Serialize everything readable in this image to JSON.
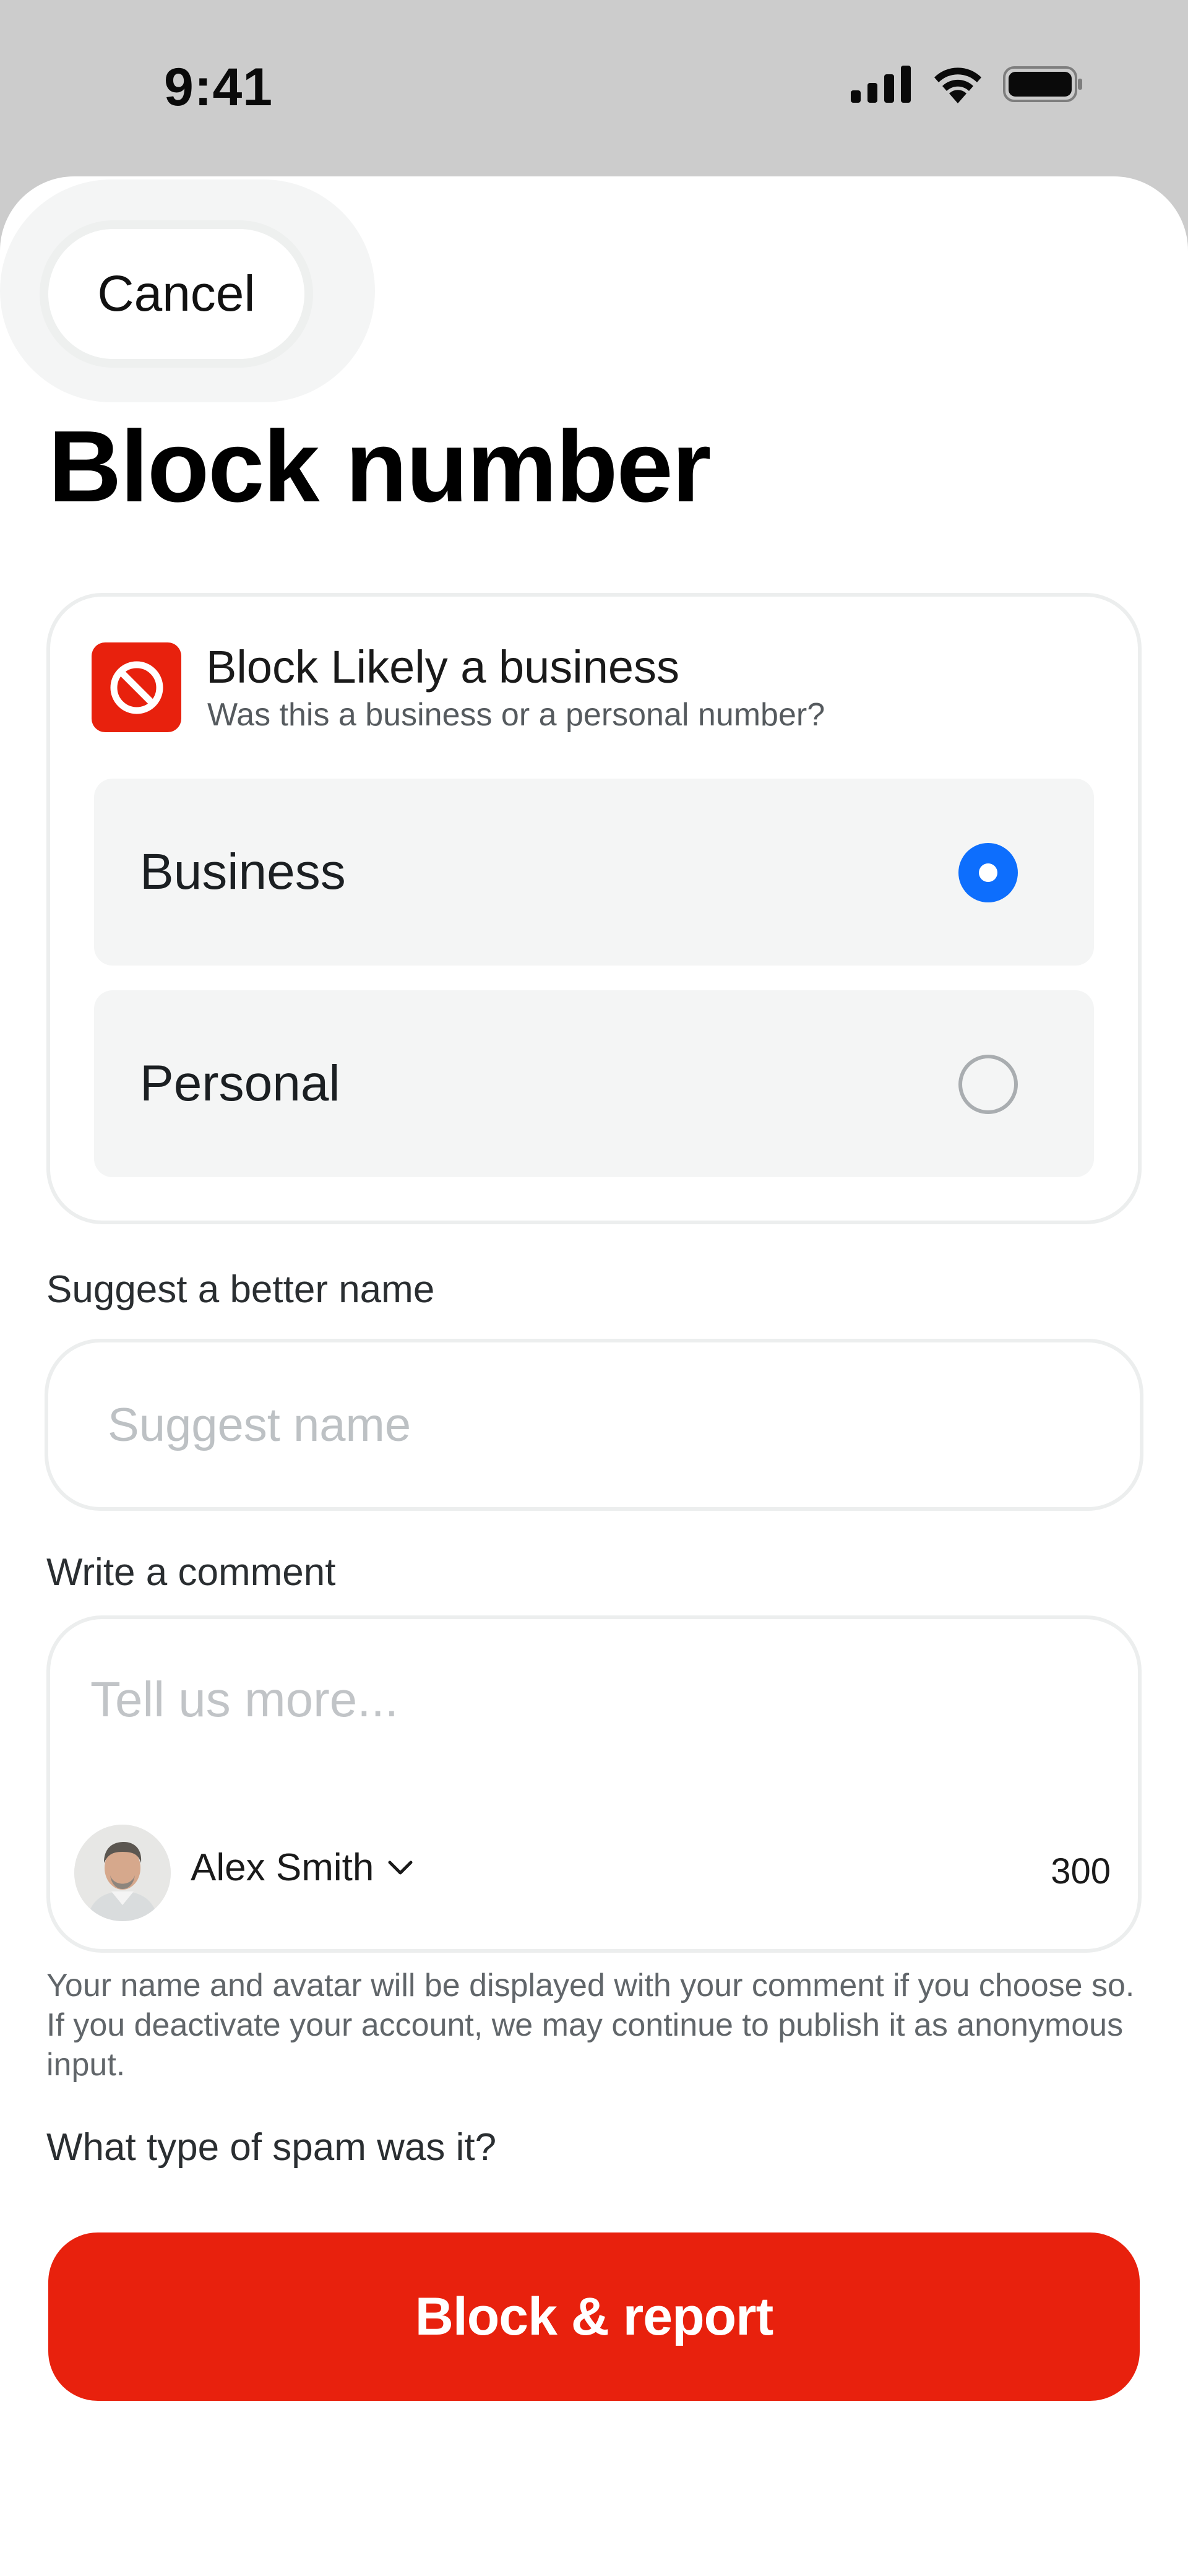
{
  "status_bar": {
    "time": "9:41",
    "icons": [
      "cellular-signal-icon",
      "wifi-icon",
      "battery-icon"
    ]
  },
  "header": {
    "cancel_label": "Cancel",
    "title": "Block number"
  },
  "block_card": {
    "icon": "block-icon",
    "heading": "Block Likely a business",
    "subheading": "Was this a business or a personal number?",
    "options": [
      {
        "label": "Business",
        "selected": true
      },
      {
        "label": "Personal",
        "selected": false
      }
    ]
  },
  "suggest": {
    "label": "Suggest a better name",
    "placeholder": "Suggest name",
    "value": ""
  },
  "comment": {
    "label": "Write a comment",
    "placeholder": "Tell us more...",
    "value": "",
    "author": "Alex Smith",
    "char_count": "300",
    "disclaimer": "Your name and avatar will be displayed with your comment if you choose so. If you deactivate your account, we may continue to publish it as anonymous input."
  },
  "spam_question": "What type of spam was it?",
  "primary_action": {
    "label": "Block & report"
  },
  "colors": {
    "accent_red": "#e8210d",
    "radio_blue": "#0d6efd",
    "status_bar_bg": "#cccccc"
  }
}
